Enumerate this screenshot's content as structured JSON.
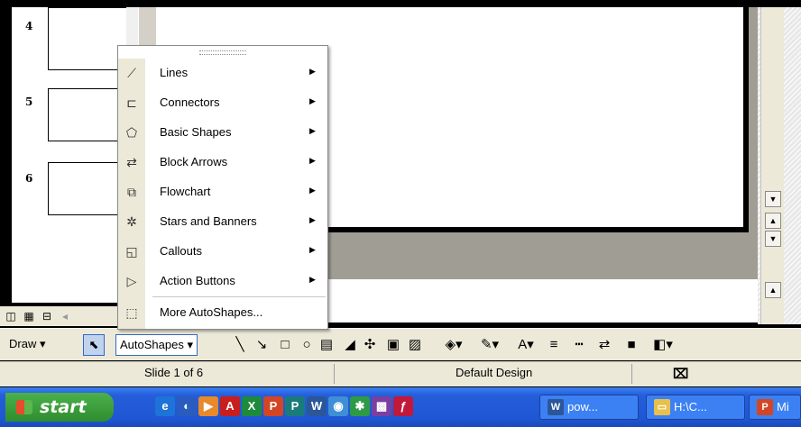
{
  "outline": {
    "slides": [
      {
        "number": "4"
      },
      {
        "number": "5"
      },
      {
        "number": "6"
      }
    ]
  },
  "scrollbar": {
    "down_arrow": "▼",
    "prev_slide": "▲",
    "next_slide": "▼",
    "up_arrow": "▲"
  },
  "view_buttons": [
    {
      "icon": "normal-view-icon",
      "glyph": "◫"
    },
    {
      "icon": "slide-sorter-icon",
      "glyph": "▦"
    },
    {
      "icon": "slide-show-icon",
      "glyph": "⊟"
    },
    {
      "icon": "scroll-left-icon",
      "glyph": "◂"
    }
  ],
  "autoshapes_menu": {
    "items": [
      {
        "label": "Lines",
        "icon": "lines-icon",
        "glyph": "⟋",
        "submenu": true
      },
      {
        "label": "Connectors",
        "icon": "connectors-icon",
        "glyph": "⊏",
        "submenu": true
      },
      {
        "label": "Basic Shapes",
        "icon": "basic-shapes-icon",
        "glyph": "⬠",
        "submenu": true
      },
      {
        "label": "Block Arrows",
        "icon": "block-arrows-icon",
        "glyph": "⇄",
        "submenu": true
      },
      {
        "label": "Flowchart",
        "icon": "flowchart-icon",
        "glyph": "⧉",
        "submenu": true
      },
      {
        "label": "Stars and Banners",
        "icon": "stars-banners-icon",
        "glyph": "✲",
        "submenu": true
      },
      {
        "label": "Callouts",
        "icon": "callouts-icon",
        "glyph": "◱",
        "submenu": true
      },
      {
        "label": "Action Buttons",
        "icon": "action-buttons-icon",
        "glyph": "▷",
        "submenu": true
      },
      {
        "label": "More AutoShapes...",
        "icon": "more-autoshapes-icon",
        "glyph": "⬚",
        "submenu": false
      }
    ],
    "submenu_arrow": "▶"
  },
  "draw_toolbar": {
    "draw_label": "Draw ▾",
    "autoshapes_label": "AutoShapes ▾",
    "tools": [
      {
        "icon": "select-pointer-icon",
        "glyph": "⬉"
      },
      {
        "icon": "line-tool-icon",
        "glyph": "╲"
      },
      {
        "icon": "arrow-tool-icon",
        "glyph": "↘"
      },
      {
        "icon": "rectangle-tool-icon",
        "glyph": "□"
      },
      {
        "icon": "oval-tool-icon",
        "glyph": "○"
      },
      {
        "icon": "text-box-icon",
        "glyph": "▤"
      },
      {
        "icon": "wordart-icon",
        "glyph": "◢"
      },
      {
        "icon": "diagram-icon",
        "glyph": "✣"
      },
      {
        "icon": "clip-art-icon",
        "glyph": "▣"
      },
      {
        "icon": "insert-picture-icon",
        "glyph": "▨"
      },
      {
        "icon": "fill-color-icon",
        "glyph": "◈▾"
      },
      {
        "icon": "line-color-icon",
        "glyph": "✎▾"
      },
      {
        "icon": "font-color-icon",
        "glyph": "A▾"
      },
      {
        "icon": "line-style-icon",
        "glyph": "≡"
      },
      {
        "icon": "dash-style-icon",
        "glyph": "┅"
      },
      {
        "icon": "arrow-style-icon",
        "glyph": "⇄"
      },
      {
        "icon": "shadow-style-icon",
        "glyph": "■"
      },
      {
        "icon": "3d-style-icon",
        "glyph": "◧▾"
      }
    ]
  },
  "status_bar": {
    "slide_position": "Slide 1 of 6",
    "design": "Default Design",
    "spelling_icon": "spelling-check-icon"
  },
  "taskbar": {
    "start_label": "start",
    "quick_launch": [
      {
        "icon": "internet-explorer-icon",
        "glyph": "e",
        "color": "#1e73d8"
      },
      {
        "icon": "firefox-icon",
        "glyph": "◐",
        "color": "#2a5bbf"
      },
      {
        "icon": "media-player-icon",
        "glyph": "▶",
        "color": "#e8892b"
      },
      {
        "icon": "acrobat-icon",
        "glyph": "A",
        "color": "#c81e1e"
      },
      {
        "icon": "excel-icon",
        "glyph": "X",
        "color": "#1e8a3c"
      },
      {
        "icon": "powerpoint-icon",
        "glyph": "P",
        "color": "#d24625"
      },
      {
        "icon": "publisher-icon",
        "glyph": "P",
        "color": "#1a7b7b"
      },
      {
        "icon": "word-icon",
        "glyph": "W",
        "color": "#2b579a"
      },
      {
        "icon": "user-icon",
        "glyph": "◉",
        "color": "#3f8fd6"
      },
      {
        "icon": "games-icon",
        "glyph": "✱",
        "color": "#2e9a45"
      },
      {
        "icon": "paint-icon",
        "glyph": "▩",
        "color": "#7a3fa0"
      },
      {
        "icon": "flash-icon",
        "glyph": "ƒ",
        "color": "#c2183a"
      }
    ],
    "tasks": [
      {
        "label": "pow...",
        "icon": "word-doc-icon",
        "glyph": "W",
        "color": "#2b579a"
      },
      {
        "label": "H:\\C...",
        "icon": "folder-icon",
        "glyph": "▭",
        "color": "#e8c04b"
      },
      {
        "label": "Mi",
        "icon": "powerpoint-task-icon",
        "glyph": "P",
        "color": "#d24625"
      }
    ]
  }
}
